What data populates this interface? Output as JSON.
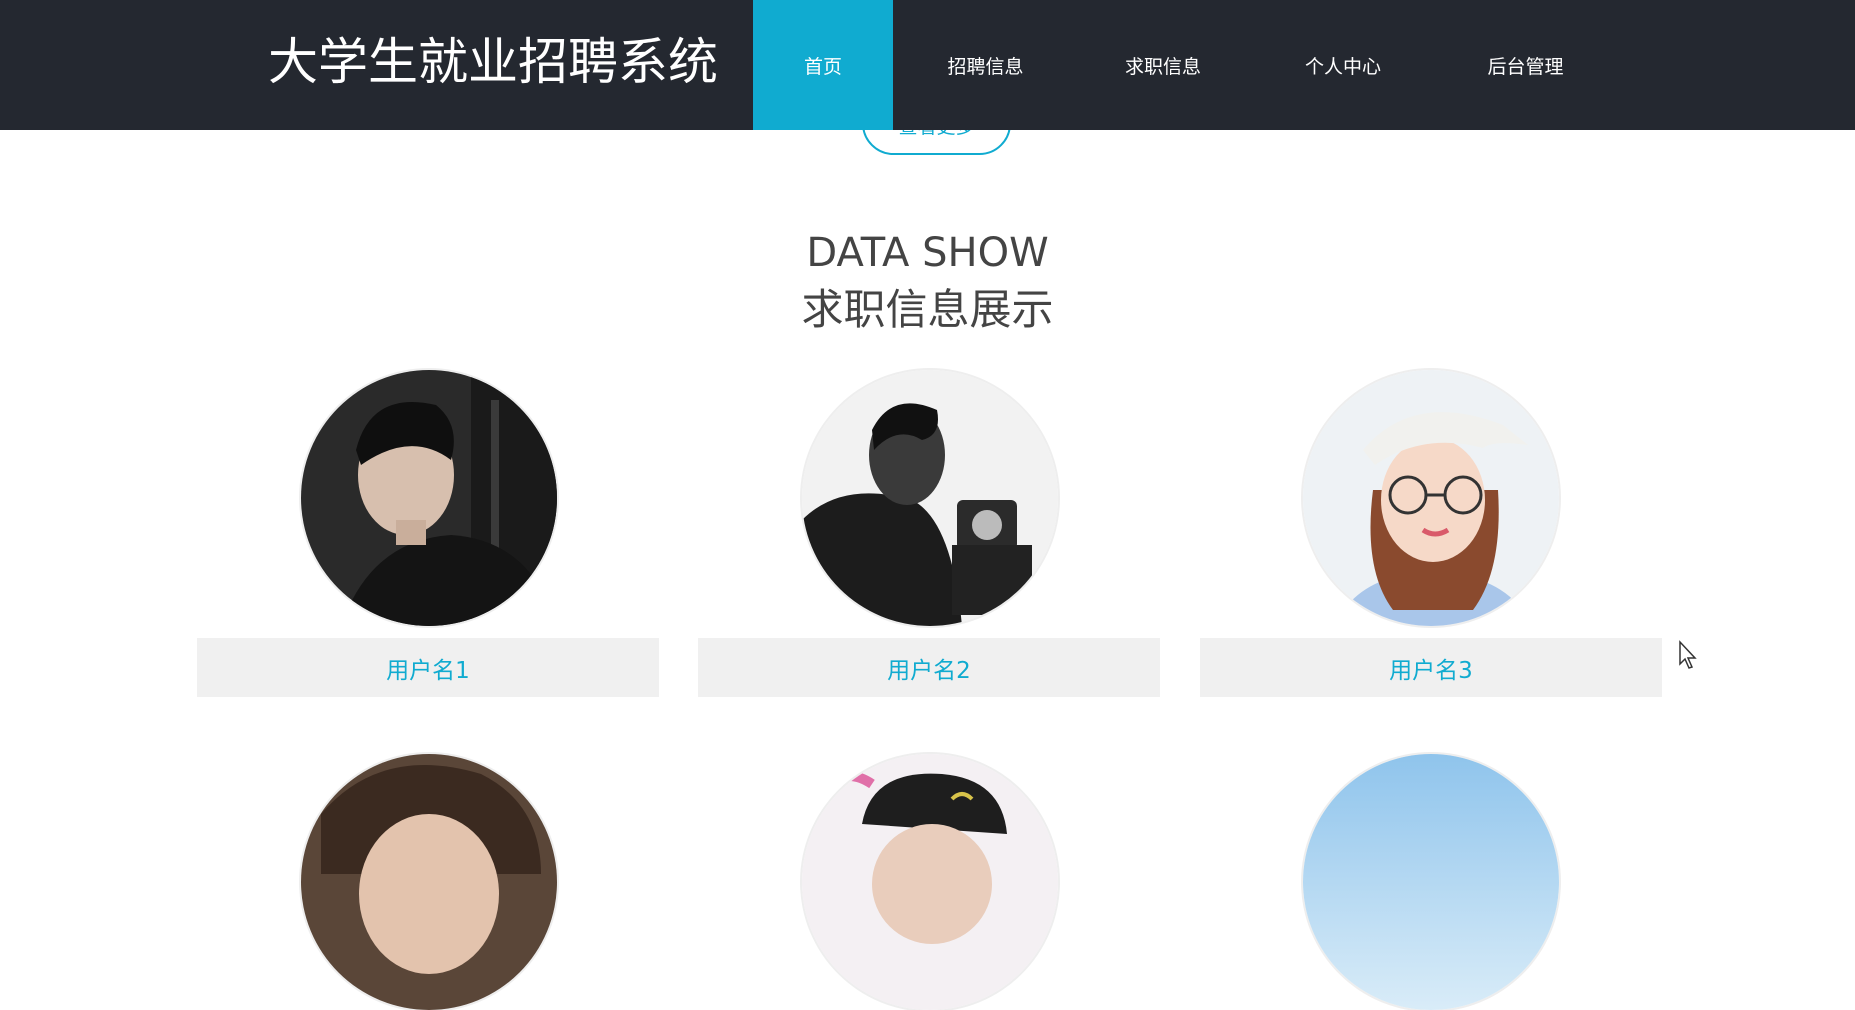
{
  "header": {
    "title": "大学生就业招聘系统",
    "nav": [
      {
        "label": "首页",
        "active": true
      },
      {
        "label": "招聘信息",
        "active": false
      },
      {
        "label": "求职信息",
        "active": false
      },
      {
        "label": "个人中心",
        "active": false
      },
      {
        "label": "后台管理",
        "active": false
      }
    ]
  },
  "more_button": {
    "label": "查看更多"
  },
  "section": {
    "title_en": "DATA SHOW",
    "title_cn": "求职信息展示"
  },
  "users": [
    {
      "name": "用户名1",
      "avatar": "avatar-photo-young-man-dark-sweater"
    },
    {
      "name": "用户名2",
      "avatar": "avatar-photo-man-with-camera-bw"
    },
    {
      "name": "用户名3",
      "avatar": "avatar-photo-woman-cap-glasses"
    },
    {
      "avatar": "avatar-photo-young-man-hair"
    },
    {
      "avatar": "avatar-photo-person-black-cap"
    },
    {
      "avatar": "avatar-photo-sky-blue"
    }
  ],
  "colors": {
    "header_bg": "#242830",
    "accent": "#10abd0",
    "name_bar_bg": "#f0f0f0",
    "title_text": "#444444"
  }
}
